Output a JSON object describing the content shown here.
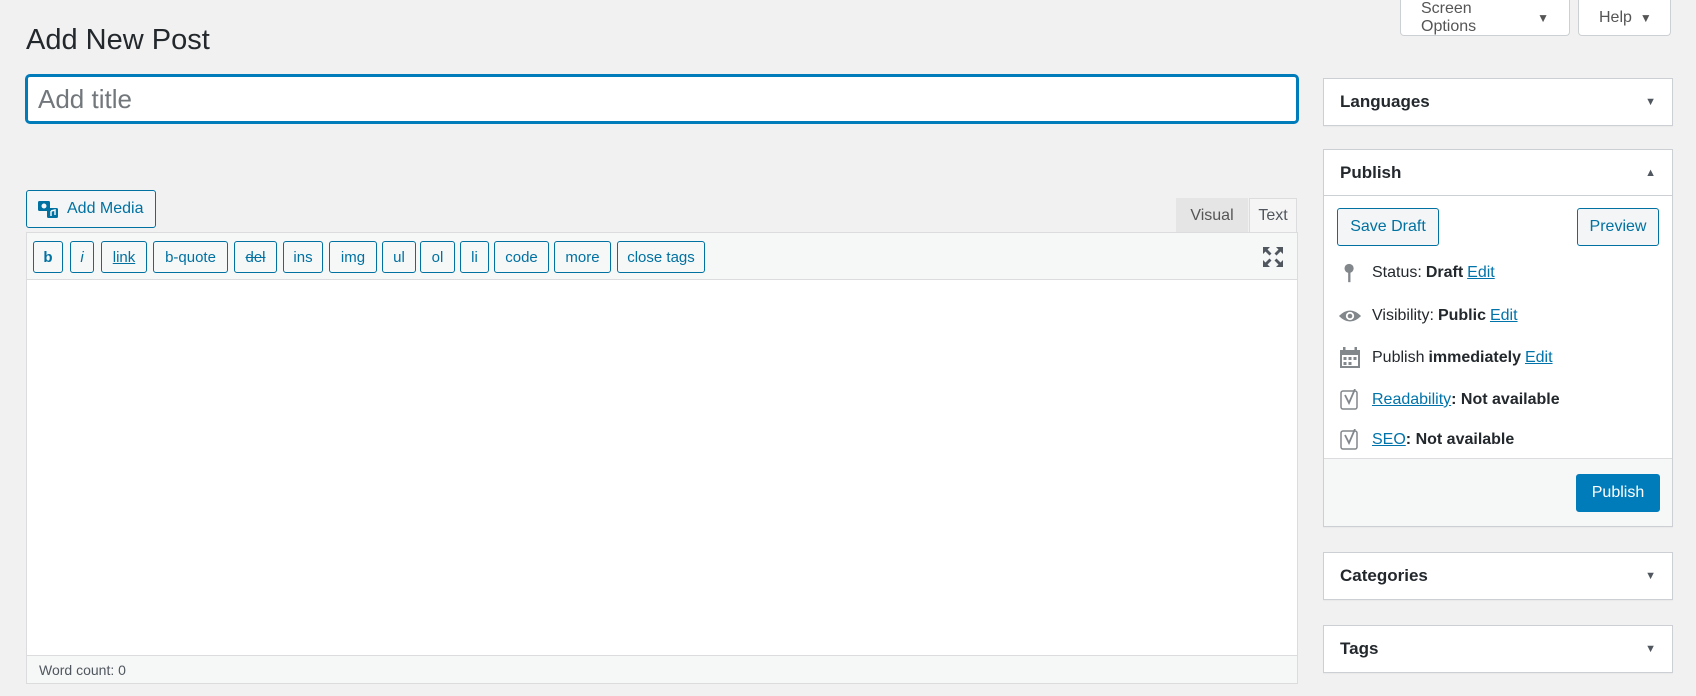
{
  "header": {
    "screen_options_label": "Screen Options",
    "help_label": "Help",
    "page_title": "Add New Post"
  },
  "title_field": {
    "placeholder": "Add title",
    "value": ""
  },
  "editor": {
    "add_media_label": "Add Media",
    "tabs": [
      {
        "label": "Visual",
        "active": false
      },
      {
        "label": "Text",
        "active": true
      }
    ],
    "quicktags": [
      "b",
      "i",
      "link",
      "b-quote",
      "del",
      "ins",
      "img",
      "ul",
      "ol",
      "li",
      "code",
      "more",
      "close tags"
    ],
    "content": "",
    "word_count": "Word count: 0"
  },
  "sidebar": {
    "languages": {
      "title": "Languages"
    },
    "publish": {
      "title": "Publish",
      "save_draft_label": "Save Draft",
      "preview_label": "Preview",
      "status_label": "Status:",
      "status_value": "Draft",
      "visibility_label": "Visibility:",
      "visibility_value": "Public",
      "publish_label": "Publish",
      "publish_value": "immediately",
      "edit_label": "Edit",
      "readability_link": "Readability",
      "readability_value": ": Not available",
      "seo_link": "SEO",
      "seo_value": ": Not available",
      "publish_button": "Publish"
    },
    "categories": {
      "title": "Categories"
    },
    "tags": {
      "title": "Tags"
    }
  },
  "colors": {
    "primary": "#007cba",
    "link": "#0073aa",
    "background": "#f1f1f1"
  }
}
